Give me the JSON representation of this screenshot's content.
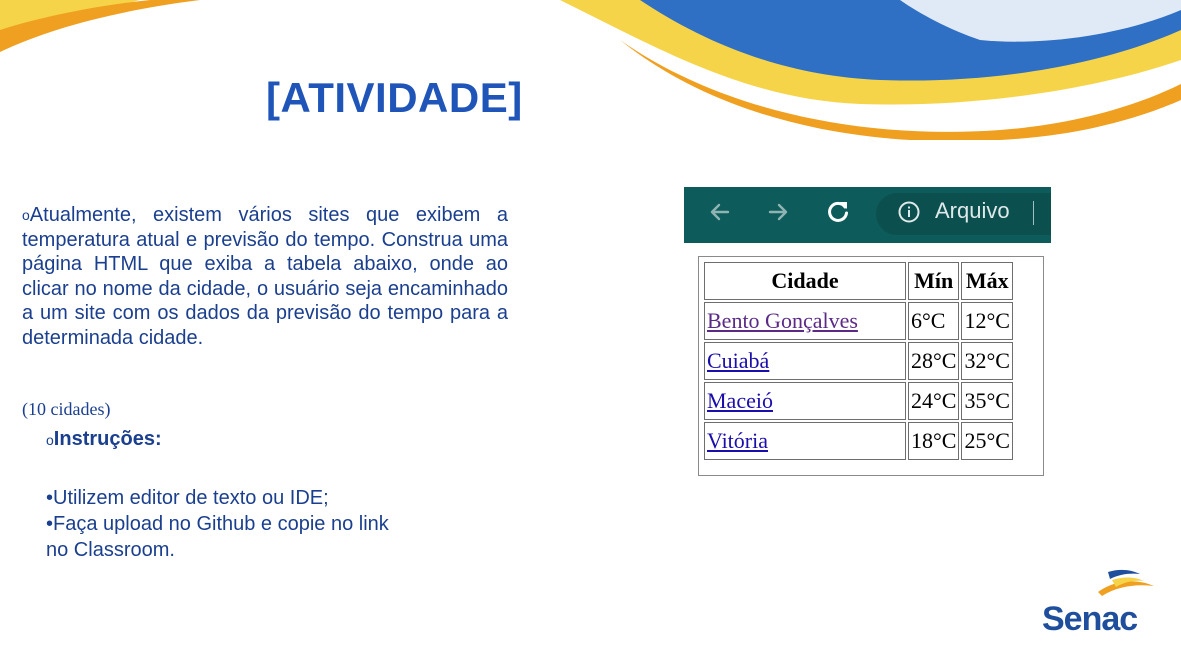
{
  "slide": {
    "title": "[ATIVIDADE]",
    "description_bullet": "o",
    "description": "Atualmente, existem vários sites que exibem a temperatura atual e previsão do tempo. Construa uma página HTML que exiba a tabela abaixo, onde ao clicar no nome da cidade, o usuário seja encaminhado a um site com os dados da previsão do tempo para a determinada cidade.",
    "count_note": "(10 cidades)",
    "instructions_bullet": "o",
    "instructions_heading": "Instruções:",
    "instructions": [
      "•Utilizem editor de texto ou IDE;",
      "•Faça upload no Github e copie no link",
      "no Classroom."
    ]
  },
  "browser": {
    "back_icon": "arrow-left-icon",
    "forward_icon": "arrow-right-icon",
    "reload_icon": "reload-icon",
    "info_icon": "info-icon",
    "address_label": "Arquivo",
    "bar_color": "#0e5b5b"
  },
  "weather_table": {
    "headers": [
      "Cidade",
      "Mín",
      "Máx"
    ],
    "rows": [
      {
        "city": "Bento Gonçalves",
        "min": "6°C",
        "max": "12°C",
        "visited": true
      },
      {
        "city": "Cuiabá",
        "min": "28°C",
        "max": "32°C",
        "visited": false
      },
      {
        "city": "Maceió",
        "min": "24°C",
        "max": "35°C",
        "visited": false
      },
      {
        "city": "Vitória",
        "min": "18°C",
        "max": "25°C",
        "visited": false
      }
    ]
  },
  "logo": {
    "text": "Senac"
  },
  "colors": {
    "title_blue": "#1f55b8",
    "text_blue": "#1b3f8f",
    "wave_blue": "#2f6fc4",
    "wave_orange": "#f0a020",
    "wave_yellow": "#f6d44a",
    "logo_blue": "#1f4f9c"
  }
}
